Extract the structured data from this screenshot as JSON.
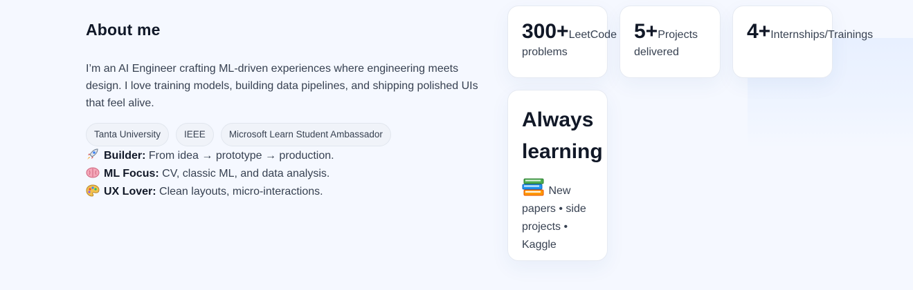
{
  "about": {
    "title": "About me",
    "bio": "I’m an AI Engineer crafting ML-driven experiences where engineering meets design. I love training models, building data pipelines, and shipping polished UIs that feel alive.",
    "chips": [
      "Tanta University",
      "IEEE",
      "Microsoft Learn Student Ambassador"
    ],
    "features": [
      {
        "icon": "rocket-icon",
        "title": "Builder:",
        "text": " From idea → prototype → production."
      },
      {
        "icon": "brain-icon",
        "title": "ML Focus:",
        "text": " CV, classic ML, and data analysis."
      },
      {
        "icon": "palette-icon",
        "title": "UX Lover:",
        "text": " Clean layouts, micro-interactions."
      }
    ]
  },
  "stats": [
    {
      "value": "300+",
      "label": "LeetCode",
      "label2": "problems"
    },
    {
      "value": "5+",
      "label": "Projects",
      "label2": "delivered"
    },
    {
      "value": "4+",
      "label": "Internships/Trainings",
      "label2": ""
    }
  ],
  "learning": {
    "title": "Always learning",
    "icon": "books-icon",
    "text": " New papers • side projects • Kaggle"
  },
  "colors": {
    "background": "#f5f8ff",
    "card": "#ffffff",
    "chip": "#f0f3f9",
    "text": "#374151",
    "heading": "#111827"
  }
}
